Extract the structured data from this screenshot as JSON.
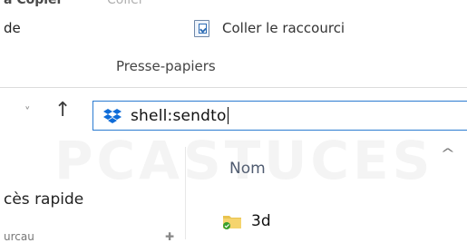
{
  "ribbon": {
    "clipped_left": "a",
    "clipped_copy": "Copier",
    "clipped_coll": "Coller",
    "left_text": "de",
    "paste_shortcut_label": "Coller le raccourci",
    "group_label": "Presse-papiers"
  },
  "nav": {
    "address_value": "shell:sendto",
    "chevron": "˅",
    "up": "↑"
  },
  "pane": {
    "quick_access": "cès rapide",
    "next_item": "urcau"
  },
  "content": {
    "column_name": "Nom",
    "sort": "^",
    "files": [
      {
        "name": "3d"
      }
    ]
  },
  "watermark": {
    "text": "PCASTUCES"
  },
  "colors": {
    "accent": "#2b7bd1",
    "dropbox": "#0f6cd8"
  }
}
